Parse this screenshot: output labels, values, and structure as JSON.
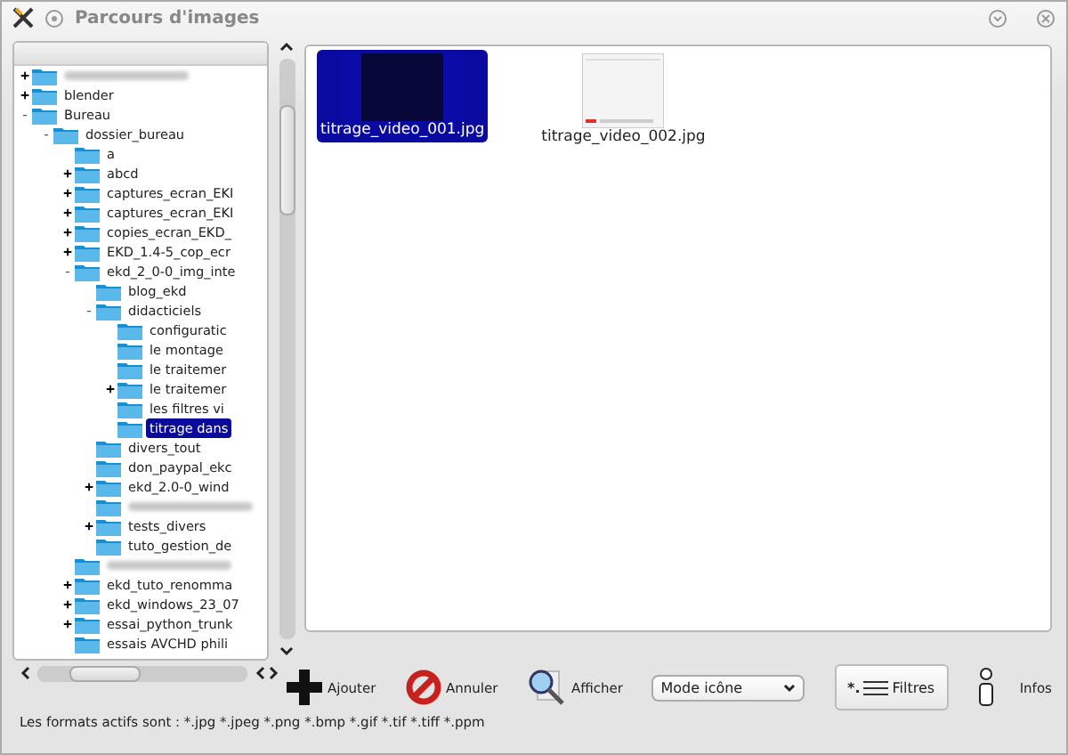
{
  "window": {
    "title": "Parcours d'images"
  },
  "tree": [
    {
      "kind": "blurred",
      "expanded": false,
      "toggle": "+"
    },
    {
      "kind": "folder",
      "label": "blender",
      "expanded": false,
      "toggle": "+"
    },
    {
      "kind": "folder",
      "label": "Bureau",
      "expanded": true,
      "toggle": "-",
      "children": [
        {
          "kind": "folder",
          "label": "dossier_bureau",
          "expanded": true,
          "toggle": "-",
          "children": [
            {
              "kind": "folder",
              "label": "a"
            },
            {
              "kind": "folder",
              "label": "abcd",
              "expanded": false,
              "toggle": "+"
            },
            {
              "kind": "folder",
              "label": "captures_ecran_EKI",
              "expanded": false,
              "toggle": "+"
            },
            {
              "kind": "folder",
              "label": "captures_ecran_EKI",
              "expanded": false,
              "toggle": "+"
            },
            {
              "kind": "folder",
              "label": "copies_ecran_EKD_",
              "expanded": false,
              "toggle": "+"
            },
            {
              "kind": "folder",
              "label": "EKD_1.4-5_cop_ecr",
              "expanded": false,
              "toggle": "+"
            },
            {
              "kind": "folder",
              "label": "ekd_2_0-0_img_inte",
              "expanded": true,
              "toggle": "-",
              "children": [
                {
                  "kind": "folder",
                  "label": "blog_ekd"
                },
                {
                  "kind": "folder",
                  "label": "didacticiels",
                  "expanded": true,
                  "toggle": "-",
                  "children": [
                    {
                      "kind": "folder",
                      "label": "configuratic"
                    },
                    {
                      "kind": "folder",
                      "label": "le montage"
                    },
                    {
                      "kind": "folder",
                      "label": "le traitemer"
                    },
                    {
                      "kind": "folder",
                      "label": "le traitemer",
                      "expanded": false,
                      "toggle": "+"
                    },
                    {
                      "kind": "folder",
                      "label": "les filtres vi"
                    },
                    {
                      "kind": "folder",
                      "label": "titrage dans",
                      "selected": true
                    }
                  ]
                },
                {
                  "kind": "folder",
                  "label": "divers_tout"
                },
                {
                  "kind": "folder",
                  "label": "don_paypal_ekc"
                },
                {
                  "kind": "folder",
                  "label": "ekd_2.0-0_wind",
                  "expanded": false,
                  "toggle": "+"
                },
                {
                  "kind": "blurred"
                },
                {
                  "kind": "folder",
                  "label": "tests_divers",
                  "expanded": false,
                  "toggle": "+"
                },
                {
                  "kind": "folder",
                  "label": "tuto_gestion_de"
                }
              ]
            },
            {
              "kind": "blurred"
            },
            {
              "kind": "folder",
              "label": "ekd_tuto_renomma",
              "expanded": false,
              "toggle": "+"
            },
            {
              "kind": "folder",
              "label": "ekd_windows_23_07",
              "expanded": false,
              "toggle": "+"
            },
            {
              "kind": "folder",
              "label": "essai_python_trunk",
              "expanded": false,
              "toggle": "+"
            },
            {
              "kind": "folder",
              "label": "essais AVCHD phili"
            }
          ]
        }
      ]
    }
  ],
  "files": [
    {
      "name": "titrage_video_001.jpg",
      "kind": "dark",
      "selected": true
    },
    {
      "name": "titrage_video_002.jpg",
      "kind": "light",
      "selected": false
    }
  ],
  "toolbar": {
    "add": "Ajouter",
    "cancel": "Annuler",
    "show": "Afficher",
    "mode": "Mode icône",
    "filters": "Filtres",
    "filters_mark": "*.",
    "info": "Infos"
  },
  "status": "Les formats actifs sont : *.jpg *.jpeg *.png *.bmp *.gif *.tif *.tiff *.ppm"
}
